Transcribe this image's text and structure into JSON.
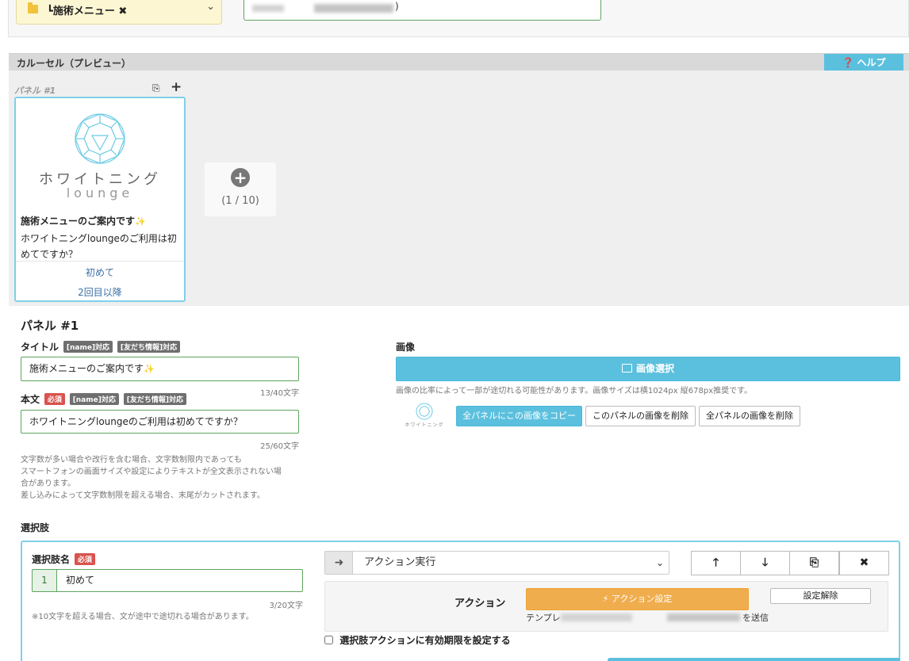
{
  "top": {
    "menu_chip": "┗施術メニュー ✖",
    "input_tail": ")"
  },
  "carousel": {
    "header": "カルーセル（プレビュー）",
    "help": "❓ ヘルプ",
    "panel_label": "パネル #1",
    "card": {
      "logo_text": "ホワイトニング",
      "logo_sub": "lounge",
      "title": "施術メニューのご案内です",
      "sparkle": "✨",
      "body": "ホワイトニングloungeのご利用は初めてですか？",
      "choices": [
        "初めて",
        "2回目以降"
      ]
    },
    "add_count": "(1 / 10)"
  },
  "panel_form": {
    "heading": "パネル #1",
    "title_label": "タイトル",
    "tag_name": "[name]対応",
    "tag_friend": "[友だち情報]対応",
    "tag_required": "必須",
    "title_value": "施術メニューのご案内です",
    "title_count": "13/40文字",
    "body_label": "本文",
    "body_value": "ホワイトニングloungeのご利用は初めてですか？",
    "body_count": "25/60文字",
    "notes": [
      "文字数が多い場合や改行を含む場合、文字数制限内であっても",
      "スマートフォンの画面サイズや設定によりテキストが全文表示されない場",
      "合があります。",
      "差し込みによって文字数制限を超える場合、末尾がカットされます。"
    ],
    "image_label": "画像",
    "image_select": "画像選択",
    "image_note": "画像の比率によって一部が途切れる可能性があります。画像サイズは横1024px 縦678px推奨です。",
    "copy_all": "全パネルにこの画像をコピー",
    "delete_this": "このパネルの画像を削除",
    "delete_all": "全パネルの画像を削除",
    "thumb_text": "ホワイトニング"
  },
  "choices_section": {
    "heading": "選択肢",
    "name_label": "選択肢名",
    "required": "必須",
    "index": "1",
    "value": "初めて",
    "count": "3/20文字",
    "note": "※10文字を超える場合、文が途中で途切れる場合があります。",
    "action_type": "アクション実行",
    "action_label": "アクション",
    "action_btn": "⚡ アクション設定",
    "release_btn": "設定解除",
    "template_prefix": "テンプレ",
    "template_suffix": "を送信",
    "expire_label": "選択肢アクションに有効期限を設定する",
    "ctrl": {
      "up": "🡑",
      "down": "🡓",
      "copy": "⎘",
      "remove": "✖"
    }
  },
  "colors": {
    "accent_blue": "#5bc0de",
    "orange": "#f0ad4e",
    "green_border": "#5ea55e",
    "tag_red": "#d9534f"
  }
}
